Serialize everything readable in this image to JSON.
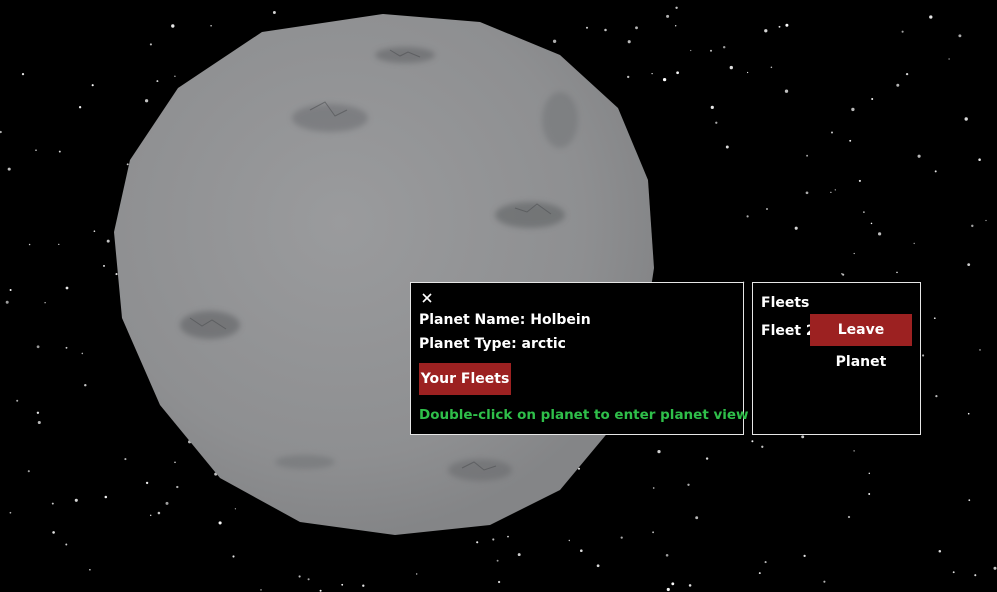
{
  "planet_info": {
    "close_icon": "close-icon",
    "name_label": "Planet Name: Holbein",
    "type_label": "Planet Type: arctic",
    "your_fleets_button": "Your Fleets",
    "hint": "Double-click on planet to enter planet view",
    "hint_color": "#2fbf4a",
    "button_color": "#9c2121"
  },
  "fleets_panel": {
    "title": "Fleets",
    "fleets": [
      {
        "name": "Fleet 2",
        "action_label": "Leave Planet"
      }
    ]
  }
}
